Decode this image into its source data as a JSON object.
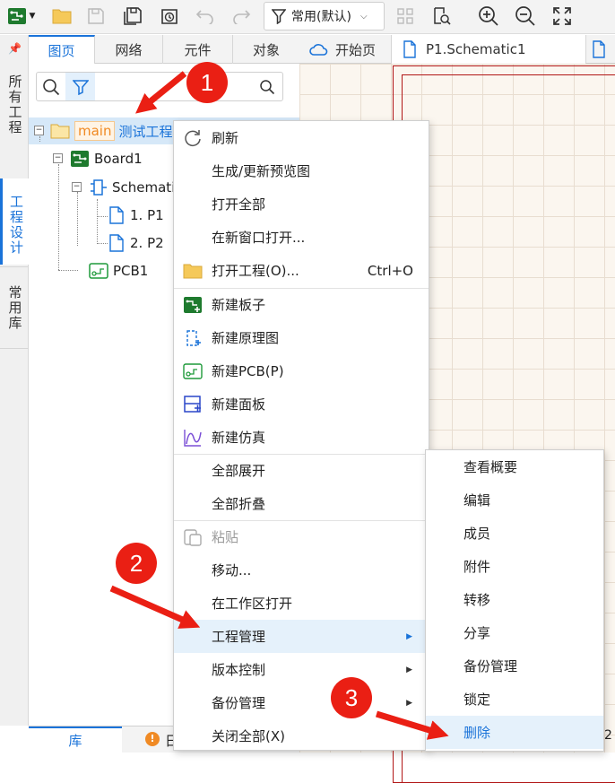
{
  "toolbar": {
    "mode_label": "常用(默认)",
    "icons": [
      "app-logo-icon",
      "open-folder-icon",
      "save-icon",
      "save-all-icon",
      "history-icon",
      "undo-icon",
      "redo-icon",
      "filter-icon",
      "grid-icon",
      "find-icon",
      "zoom-in-icon",
      "zoom-out-icon",
      "fit-icon"
    ]
  },
  "side_tabs": [
    {
      "label": "所有工程"
    },
    {
      "label": "工程设计"
    },
    {
      "label": "常用库"
    }
  ],
  "panel_tabs": [
    {
      "label": "图页"
    },
    {
      "label": "网络"
    },
    {
      "label": "元件"
    },
    {
      "label": "对象"
    }
  ],
  "doc_tabs": [
    {
      "label": "开始页"
    },
    {
      "label": "P1.Schematic1"
    }
  ],
  "tree": {
    "project_tag": "main",
    "project_name": "测试工程",
    "board": "Board1",
    "schematic": "Schemati",
    "pages": [
      "1. P1",
      "2. P2"
    ],
    "pcb": "PCB1"
  },
  "context_menu": {
    "items": [
      {
        "label": "刷新",
        "icon": "refresh-icon"
      },
      {
        "label": "生成/更新预览图"
      },
      {
        "label": "打开全部"
      },
      {
        "label": "在新窗口打开..."
      },
      {
        "label": "打开工程(O)...",
        "shortcut": "Ctrl+O",
        "icon": "folder-icon"
      },
      {
        "label": "新建板子",
        "icon": "new-board-icon"
      },
      {
        "label": "新建原理图",
        "icon": "new-schematic-icon"
      },
      {
        "label": "新建PCB(P)",
        "icon": "new-pcb-icon"
      },
      {
        "label": "新建面板",
        "icon": "new-panel-icon"
      },
      {
        "label": "新建仿真",
        "icon": "new-simulation-icon"
      },
      {
        "label": "全部展开"
      },
      {
        "label": "全部折叠"
      },
      {
        "label": "粘贴",
        "icon": "paste-icon",
        "disabled": true
      },
      {
        "label": "移动..."
      },
      {
        "label": "在工作区打开"
      },
      {
        "label": "工程管理",
        "submenu": true,
        "highlighted": true
      },
      {
        "label": "版本控制",
        "submenu": true
      },
      {
        "label": "备份管理",
        "submenu": true
      },
      {
        "label": "关闭全部(X)"
      }
    ]
  },
  "submenu": {
    "items": [
      {
        "label": "查看概要"
      },
      {
        "label": "编辑"
      },
      {
        "label": "成员"
      },
      {
        "label": "附件"
      },
      {
        "label": "转移"
      },
      {
        "label": "分享"
      },
      {
        "label": "备份管理"
      },
      {
        "label": "锁定"
      },
      {
        "label": "删除",
        "highlighted": true
      }
    ]
  },
  "bottom_bar": {
    "lib_label": "库",
    "partial_label": "日",
    "right_digit": "2"
  },
  "callouts": [
    {
      "number": "1"
    },
    {
      "number": "2"
    },
    {
      "number": "3"
    }
  ],
  "colors": {
    "accent": "#1a73d9",
    "callout": "#ea1f14",
    "menu_highlight": "#e5f1fb",
    "canvas": "#fbf6ef",
    "tag_orange": "#f08a24"
  }
}
